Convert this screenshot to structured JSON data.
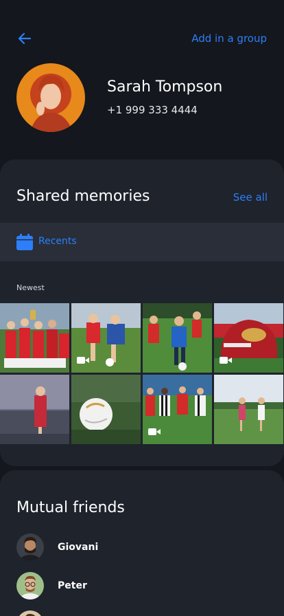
{
  "header": {
    "add_group_label": "Add in a group"
  },
  "contact": {
    "name": "Sarah Tompson",
    "phone": "+1 999 333 4444"
  },
  "memories": {
    "title": "Shared memories",
    "see_all_label": "See all",
    "recents_label": "Recents",
    "newest_label": "Newest",
    "tiles": [
      {
        "scene": "team-trophy",
        "video": false
      },
      {
        "scene": "kids-kicking",
        "video": true
      },
      {
        "scene": "kids-running-blue",
        "video": false
      },
      {
        "scene": "inflatable-helmet",
        "video": true
      },
      {
        "scene": "cheerleaders",
        "video": false
      },
      {
        "scene": "soccer-ball",
        "video": false
      },
      {
        "scene": "kids-striped-match",
        "video": true
      },
      {
        "scene": "girls-field",
        "video": false
      }
    ]
  },
  "friends": {
    "title": "Mutual friends",
    "items": [
      {
        "name": "Giovani"
      },
      {
        "name": "Peter"
      }
    ]
  },
  "colors": {
    "background": "#14171d",
    "card": "#1f232c",
    "accent": "#2d7ff9"
  },
  "icons": [
    "arrow-left-icon",
    "calendar-icon",
    "video-icon"
  ]
}
